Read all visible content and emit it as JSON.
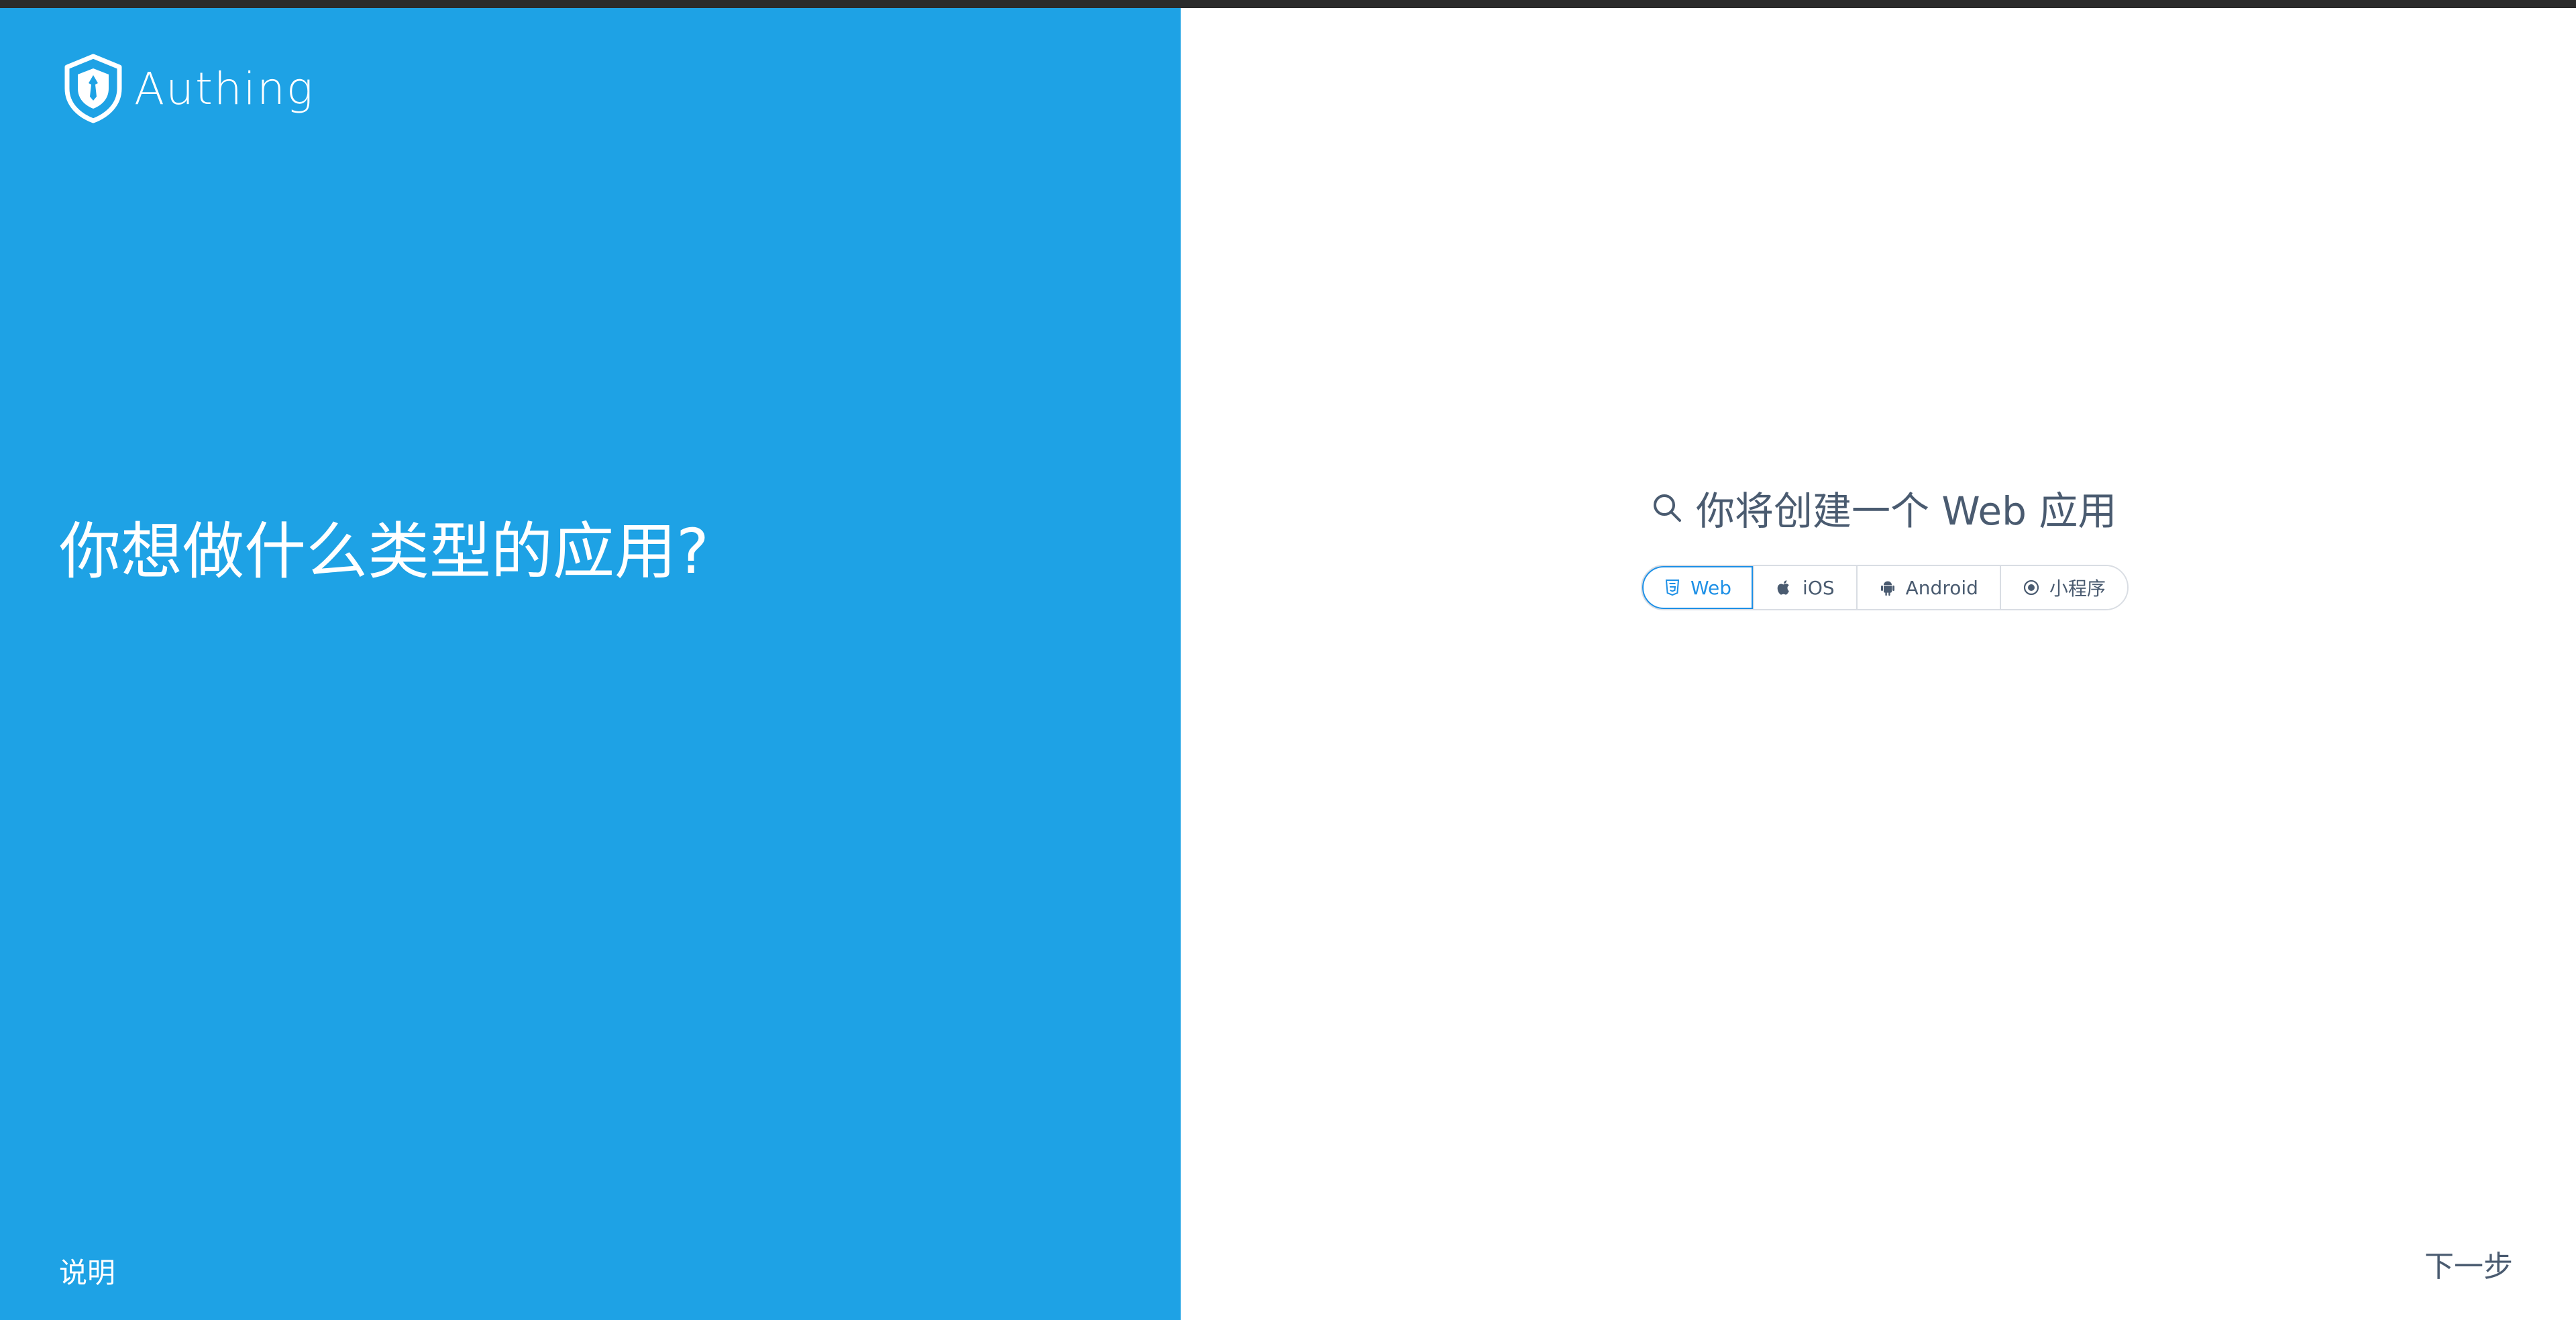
{
  "window": {
    "title_bar_color": "#2b2b2b"
  },
  "left_panel": {
    "background": "#1ea2e5",
    "logo_text": "Authing",
    "question": "你想做什么类型的应用?",
    "help_link": "说明"
  },
  "right_panel": {
    "headline": "你将创建一个 Web 应用",
    "headline_icon": "search-icon",
    "tabs": [
      {
        "label": "Web",
        "icon": "html5-icon",
        "active": true
      },
      {
        "label": "iOS",
        "icon": "apple-icon",
        "active": false
      },
      {
        "label": "Android",
        "icon": "android-icon",
        "active": false
      },
      {
        "label": "小程序",
        "icon": "mini-program-icon",
        "active": false
      }
    ],
    "next_link": "下一步",
    "accent_color": "#1e90e6"
  }
}
